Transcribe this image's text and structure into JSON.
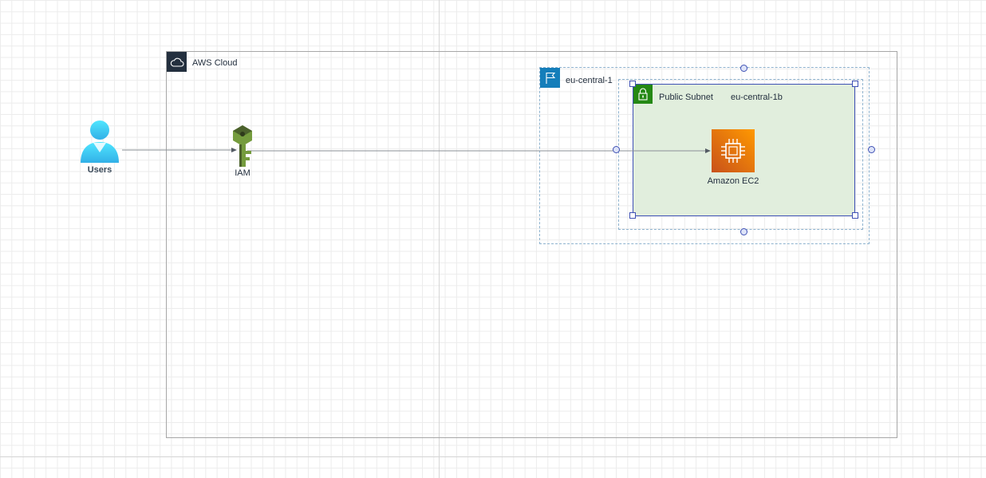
{
  "nodes": {
    "users": {
      "label": "Users"
    },
    "iam": {
      "label": "IAM"
    },
    "ec2": {
      "label": "Amazon EC2"
    }
  },
  "groups": {
    "aws_cloud": {
      "label": "AWS Cloud"
    },
    "region": {
      "label": "eu-central-1"
    },
    "availability_zone": {
      "label": "eu-central-1b"
    },
    "public_subnet": {
      "label": "Public Subnet"
    }
  },
  "colors": {
    "aws_cloud_header": "#232f3e",
    "region_header": "#147eba",
    "subnet_header": "#248814",
    "subnet_fill": "#e1eedd",
    "ec2_gradient_start": "#c8511b",
    "ec2_gradient_end": "#ff9900",
    "iam_key": "#759c3e",
    "users_icon": "#50e6ff",
    "selection_handle": "#3f51b5"
  },
  "icons": {
    "aws_cloud": "cloud-icon",
    "region": "flag-icon",
    "public_subnet": "lock-icon",
    "ec2": "ec2-chip-icon",
    "iam": "iam-key-icon",
    "users": "user-icon"
  }
}
